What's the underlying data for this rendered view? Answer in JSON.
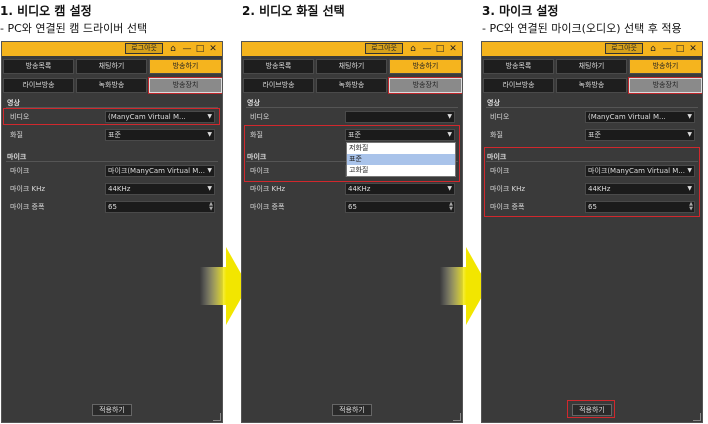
{
  "steps": [
    {
      "title": "1. 비디오 캠 설정",
      "subtitle": "- PC와 연결된 캠 드라이버 선택"
    },
    {
      "title": "2. 비디오 화질 선택",
      "subtitle": ""
    },
    {
      "title": "3. 마이크 설정",
      "subtitle": "- PC와 연결된 마이크(오디오) 선택 후 적용"
    }
  ],
  "app": {
    "login_label": "로그아웃",
    "tabs_row1": [
      "방송목록",
      "채팅하기",
      "방송하기"
    ],
    "tabs_row2": [
      "라이브방송",
      "녹화방송",
      "방송장치"
    ],
    "video_section": "영상",
    "video_label": "비디오",
    "video_value": "(ManyCam Virtual M...",
    "quality_label": "화질",
    "quality_value": "표준",
    "mic_section": "마이크",
    "mic_label": "마이크",
    "mic_value": "마이크(ManyCam Virtual M...",
    "khz_label": "마이크 KHz",
    "khz_value": "44KHz",
    "volume_label": "마이크 증폭",
    "volume_value": "65",
    "apply_label": "적용하기",
    "quality_options": [
      "저화질",
      "표준",
      "고화질"
    ],
    "quality_selected_option": "표준"
  },
  "colors": {
    "titlebar": "#f5b41e",
    "panel_bg": "#3a3a3a",
    "highlight": "#d0282d",
    "arrow": "#f2e600"
  },
  "icons": [
    "home-icon",
    "minimize-icon",
    "maximize-icon",
    "close-icon",
    "dropdown-arrow-icon",
    "spinner-icon",
    "resize-grip-icon",
    "next-step-arrow-icon"
  ]
}
